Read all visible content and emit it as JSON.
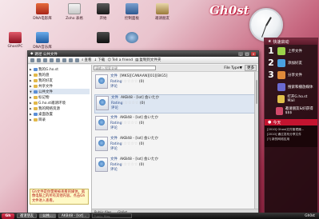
{
  "desktop_icons": [
    {
      "label": "DNA电影库",
      "color": "#d24a2a"
    },
    {
      "label": "Zoho 表格",
      "color": "#e8e8e8"
    },
    {
      "label": "开始",
      "color": "#3a3a3a"
    },
    {
      "label": "控制面板",
      "color": "#4a6a9a"
    },
    {
      "label": "邀请朋友",
      "color": "#b9a06a"
    },
    {
      "label": "GhostPC",
      "color": "#c2283a"
    },
    {
      "label": "DNA音乐库",
      "color": "#3a78c0"
    },
    {
      "label": "",
      "color": "#2a2a2a"
    },
    {
      "label": "",
      "color": "#6a8ab0"
    }
  ],
  "logo": {
    "text": "Gh0st"
  },
  "sidebar": {
    "header": "快速启动",
    "items": [
      {
        "num": "1",
        "label": "上传文件",
        "color": "#9bd24a"
      },
      {
        "num": "2",
        "label": "添加好友",
        "color": "#4aa0e0"
      },
      {
        "num": "3",
        "label": "分享文件",
        "color": "#e08a3a"
      },
      {
        "num": "",
        "label": "搜索和播放媒体",
        "color": "#6a6ad0"
      },
      {
        "num": "",
        "label": "打开G.ho.st Mail",
        "color": "#e0c04a"
      },
      {
        "num": "",
        "label": "邀请朋友&好获得 $$$",
        "color": "#d04a6a"
      }
    ],
    "news_header": "今天",
    "news": [
      "[2010] Ghost文件管理器...",
      "[2010] 通过发布分享文件",
      "[?] 新的网络应用"
    ]
  },
  "window": {
    "title": "公共文件",
    "app_label": "路径 公共文件",
    "toolbar": {
      "search": "查看",
      "download": "下载",
      "tell_friend": "Tell a friend",
      "copy_to": "复制到文件夹"
    },
    "tree": [
      {
        "label": "我的G.ho.st",
        "color": "#5a8ed6",
        "arrow": "▶"
      },
      {
        "label": "我的盘",
        "color": "#e2b84a",
        "arrow": "▶"
      },
      {
        "label": "我的好友",
        "color": "#e2b84a",
        "arrow": "▶"
      },
      {
        "label": "共享文件",
        "color": "#e2b84a",
        "arrow": "▶"
      },
      {
        "label": "公共文件",
        "color": "#5a8ed6",
        "arrow": "▼"
      },
      {
        "label": "标记物",
        "color": "#e2b84a",
        "arrow": "▶"
      },
      {
        "label": "G.ho.st邀请环境",
        "color": "#e2b84a",
        "arrow": "▶"
      },
      {
        "label": "我的网络资源",
        "color": "#e2b84a",
        "arrow": "▶"
      },
      {
        "label": "桌面放置",
        "color": "#5a8ed6",
        "arrow": "▶"
      },
      {
        "label": "目录",
        "color": "#e2b84a",
        "arrow": "▶"
      }
    ],
    "search_placeholder": "请输入搜索关键",
    "file_type": "File Type▼",
    "more": "更多",
    "files": [
      {
        "name": "[MKS][CANAAN][01][BIG5]",
        "rating": "(0)"
      },
      {
        "name": "AKB48 - [lot] 会いたか",
        "rating": "(0)"
      },
      {
        "name": "AKB48 - [lot] 会いたか",
        "rating": "(0)"
      },
      {
        "name": "AKB48 - [lot] 会いたか",
        "rating": "(0)"
      },
      {
        "name": "AKB48 - [lot] 会いたか",
        "rating": "(0)"
      }
    ],
    "file_labels": {
      "file": "文件",
      "rating": "Rating",
      "comment": "评论"
    },
    "stars": "☆☆☆☆☆",
    "tip": "Gh文件是你需要被查看的媒体，就像电脑上的所有其他内容。点击Gh文件进入查看。",
    "status": {
      "left": "",
      "center": "Public files",
      "right": "Gh0st"
    }
  },
  "taskbar": {
    "start_label": "Gh",
    "tasks": [
      "邀请朋友",
      "公共...",
      "AKB48 - [lot]...",
      ""
    ],
    "search_placeholder": "Public files",
    "tray_brand": "Gh0st"
  }
}
